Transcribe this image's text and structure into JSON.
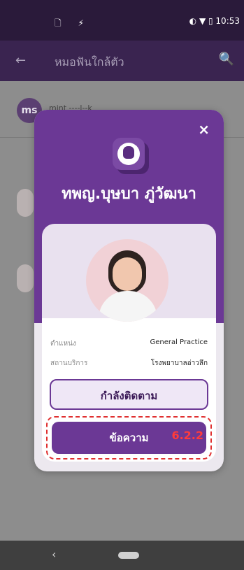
{
  "status_bar": {
    "left_icons": "🗋 ⚡",
    "right_text": "◐ ▼ ▯ 10:53"
  },
  "app_bar": {
    "back_icon": "←",
    "title": "หมอฟันใกล้ตัว",
    "search_icon": "🔍"
  },
  "background_list": {
    "avatar_initials": "ms",
    "name_text": "mint ----l--k"
  },
  "modal": {
    "close_icon": "×",
    "logo_icon": "tooth-logo-icon",
    "doctor_name": "ทพญ.บุษบา ภู่วัฒนา",
    "fields": [
      {
        "label": "ตำแหน่ง",
        "value": "General Practice"
      },
      {
        "label": "สถานบริการ",
        "value": "โรงพยาบาลอ่าวลึก"
      }
    ],
    "follow_button_label": "กำลังติดตาม",
    "message_button_label": "ข้อความ",
    "message_annotation": "6.2.2"
  },
  "nav_bar": {
    "back_icon": "‹",
    "home_indicator": ""
  },
  "colors": {
    "primary": "#6b3895",
    "dark": "#3a2450",
    "annotation": "#e03030"
  }
}
